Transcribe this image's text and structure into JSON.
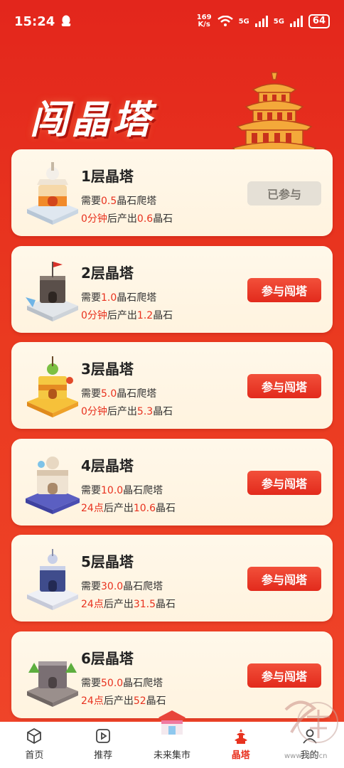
{
  "status_bar": {
    "time": "15:24",
    "speed_value": "169",
    "speed_unit": "K/s",
    "net1": "5G",
    "net2": "5G",
    "battery": "64"
  },
  "hero": {
    "title": "闯晶塔"
  },
  "towers": [
    {
      "title": "1层晶塔",
      "need_prefix": "需要",
      "need_value": "0.5",
      "need_suffix": "晶石爬塔",
      "time_value": "0分钟",
      "out_mid": "后产出",
      "out_value": "0.6",
      "out_suffix": "晶石",
      "button": "已参与",
      "joined": true
    },
    {
      "title": "2层晶塔",
      "need_prefix": "需要",
      "need_value": "1.0",
      "need_suffix": "晶石爬塔",
      "time_value": "0分钟",
      "out_mid": "后产出",
      "out_value": "1.2",
      "out_suffix": "晶石",
      "button": "参与闯塔",
      "joined": false
    },
    {
      "title": "3层晶塔",
      "need_prefix": "需要",
      "need_value": "5.0",
      "need_suffix": "晶石爬塔",
      "time_value": "0分钟",
      "out_mid": "后产出",
      "out_value": "5.3",
      "out_suffix": "晶石",
      "button": "参与闯塔",
      "joined": false
    },
    {
      "title": "4层晶塔",
      "need_prefix": "需要",
      "need_value": "10.0",
      "need_suffix": "晶石爬塔",
      "time_value": "24点",
      "out_mid": "后产出",
      "out_value": "10.6",
      "out_suffix": "晶石",
      "button": "参与闯塔",
      "joined": false
    },
    {
      "title": "5层晶塔",
      "need_prefix": "需要",
      "need_value": "30.0",
      "need_suffix": "晶石爬塔",
      "time_value": "24点",
      "out_mid": "后产出",
      "out_value": "31.5",
      "out_suffix": "晶石",
      "button": "参与闯塔",
      "joined": false
    },
    {
      "title": "6层晶塔",
      "need_prefix": "需要",
      "need_value": "50.0",
      "need_suffix": "晶石爬塔",
      "time_value": "24点",
      "out_mid": "后产出",
      "out_value": "52",
      "out_suffix": "晶石",
      "button": "参与闯塔",
      "joined": false
    }
  ],
  "tabbar": {
    "items": [
      {
        "label": "首页",
        "icon": "cube-icon"
      },
      {
        "label": "推荐",
        "icon": "play-icon"
      },
      {
        "label": "未来集市",
        "icon": "market-shop-icon"
      },
      {
        "label": "晶塔",
        "icon": "tower-icon",
        "active": true
      },
      {
        "label": "我的",
        "icon": "profile-icon"
      }
    ]
  },
  "watermark": {
    "text": "www.5aa.cn"
  },
  "colors": {
    "accent": "#e8321f",
    "background": "#e3261c",
    "card": "#fff8ea",
    "disabled_button": "#e5e0d6"
  }
}
